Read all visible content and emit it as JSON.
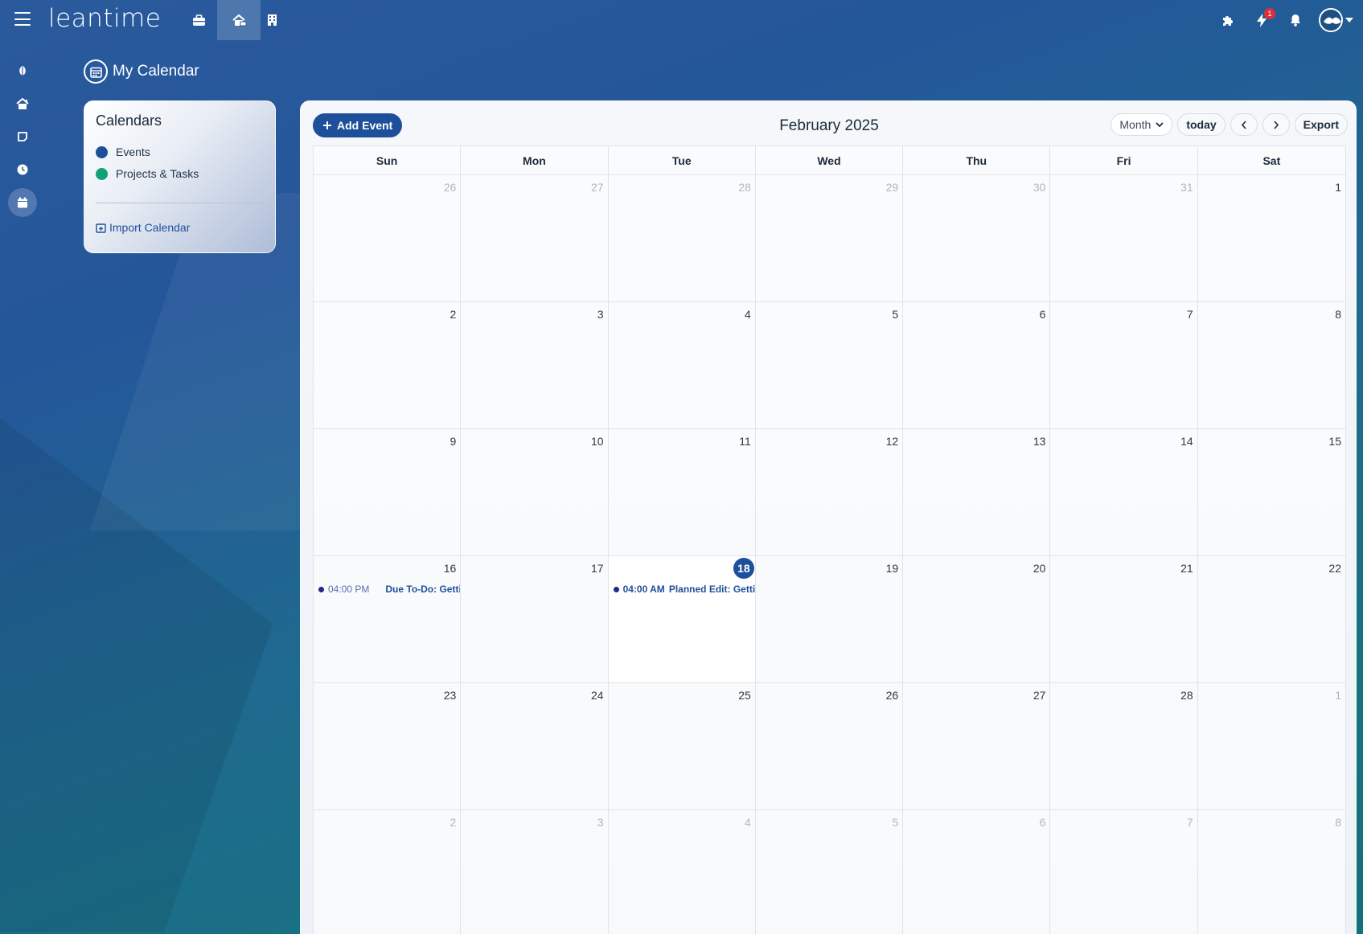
{
  "app": {
    "logo": "leantime"
  },
  "topbar": {
    "nav": [
      {
        "name": "briefcase-icon"
      },
      {
        "name": "home-work-icon"
      },
      {
        "name": "building-icon"
      }
    ],
    "right_icons": [
      "puzzle-icon",
      "bolt-icon",
      "bell-icon"
    ],
    "bolt_badge": "1"
  },
  "rail": [
    "leaf-icon",
    "home-icon",
    "note-icon",
    "clock-icon",
    "calendar-icon"
  ],
  "page": {
    "title": "My Calendar"
  },
  "calendars": {
    "title": "Calendars",
    "items": [
      {
        "label": "Events",
        "color": "#1e4f9a"
      },
      {
        "label": "Projects & Tasks",
        "color": "#12a07a"
      }
    ],
    "import_label": "Import Calendar"
  },
  "calendar": {
    "add_event": "Add Event",
    "month_title": "February 2025",
    "view_select": "Month",
    "today": "today",
    "export": "Export",
    "weekdays": [
      "Sun",
      "Mon",
      "Tue",
      "Wed",
      "Thu",
      "Fri",
      "Sat"
    ],
    "weeks": [
      [
        {
          "d": "26",
          "o": true
        },
        {
          "d": "27",
          "o": true
        },
        {
          "d": "28",
          "o": true
        },
        {
          "d": "29",
          "o": true
        },
        {
          "d": "30",
          "o": true
        },
        {
          "d": "31",
          "o": true
        },
        {
          "d": "1",
          "o": false
        }
      ],
      [
        {
          "d": "2",
          "o": false
        },
        {
          "d": "3",
          "o": false
        },
        {
          "d": "4",
          "o": false
        },
        {
          "d": "5",
          "o": false
        },
        {
          "d": "6",
          "o": false
        },
        {
          "d": "7",
          "o": false
        },
        {
          "d": "8",
          "o": false
        }
      ],
      [
        {
          "d": "9",
          "o": false
        },
        {
          "d": "10",
          "o": false
        },
        {
          "d": "11",
          "o": false
        },
        {
          "d": "12",
          "o": false
        },
        {
          "d": "13",
          "o": false
        },
        {
          "d": "14",
          "o": false
        },
        {
          "d": "15",
          "o": false
        }
      ],
      [
        {
          "d": "16",
          "o": false
        },
        {
          "d": "17",
          "o": false
        },
        {
          "d": "18",
          "o": false,
          "today": true
        },
        {
          "d": "19",
          "o": false
        },
        {
          "d": "20",
          "o": false
        },
        {
          "d": "21",
          "o": false
        },
        {
          "d": "22",
          "o": false
        }
      ],
      [
        {
          "d": "23",
          "o": false
        },
        {
          "d": "24",
          "o": false
        },
        {
          "d": "25",
          "o": false
        },
        {
          "d": "26",
          "o": false
        },
        {
          "d": "27",
          "o": false
        },
        {
          "d": "28",
          "o": false
        },
        {
          "d": "1",
          "o": true
        }
      ],
      [
        {
          "d": "2",
          "o": true
        },
        {
          "d": "3",
          "o": true
        },
        {
          "d": "4",
          "o": true
        },
        {
          "d": "5",
          "o": true
        },
        {
          "d": "6",
          "o": true
        },
        {
          "d": "7",
          "o": true
        },
        {
          "d": "8",
          "o": true
        }
      ]
    ],
    "events": [
      {
        "week": 3,
        "day": 0,
        "time": "04:00 PM",
        "title": "Due To-Do: Getting",
        "style": "list"
      },
      {
        "week": 3,
        "day": 2,
        "time": "04:00 AM",
        "title": "Planned Edit: Getting",
        "style": "bold"
      }
    ]
  }
}
